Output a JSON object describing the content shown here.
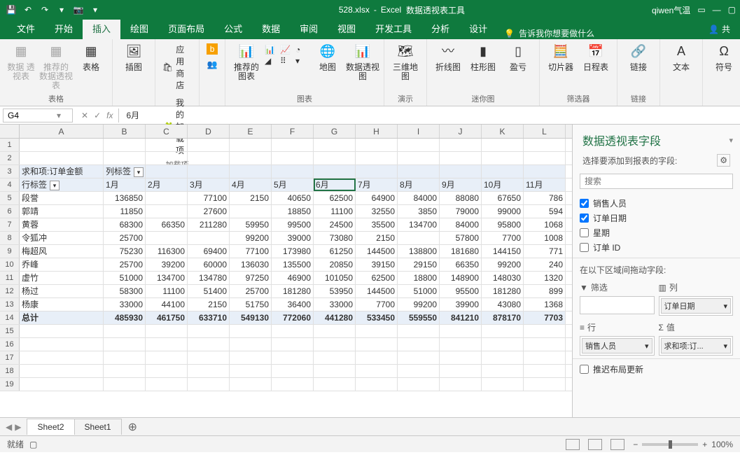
{
  "title": {
    "filename": "528.xlsx",
    "app": "Excel",
    "tool": "数据透视表工具",
    "user": "qiwen气温"
  },
  "tabs": [
    "文件",
    "开始",
    "插入",
    "绘图",
    "页面布局",
    "公式",
    "数据",
    "审阅",
    "视图",
    "开发工具",
    "分析",
    "设计"
  ],
  "tell": "告诉我你想要做什么",
  "share": "共",
  "ribbon": {
    "pivot": {
      "pt": "数据\n透视表",
      "rec": "推荐的\n数据透视表",
      "table": "表格",
      "group": "表格"
    },
    "illus": {
      "pic": "插图",
      "group": ""
    },
    "addins": {
      "store": "应用商店",
      "myaddins": "我的加载项",
      "bing": "",
      "people": "",
      "group": "加载项"
    },
    "charts": {
      "rec": "推荐的\n图表",
      "group": "图表",
      "map": "地图",
      "pivotchart": "数据透视图"
    },
    "tours": {
      "map": "三维地\n图",
      "group": "演示"
    },
    "spark": {
      "line": "折线图",
      "col": "柱形图",
      "winloss": "盈亏",
      "group": "迷你图"
    },
    "filter": {
      "slicer": "切片器",
      "timeline": "日程表",
      "group": "筛选器"
    },
    "link": {
      "link": "链接",
      "group": "链接"
    },
    "text": {
      "text": "文本",
      "group": ""
    },
    "sym": {
      "sym": "符号",
      "group": ""
    }
  },
  "formula": {
    "cell": "G4",
    "value": "6月",
    "fx": "fx"
  },
  "cols": [
    "A",
    "B",
    "C",
    "D",
    "E",
    "F",
    "G",
    "H",
    "I",
    "J",
    "K",
    "L"
  ],
  "pivot": {
    "measure": "求和项:订单金额",
    "collabel": "列标签",
    "rowlabel": "行标签",
    "months": [
      "1月",
      "2月",
      "3月",
      "4月",
      "5月",
      "6月",
      "7月",
      "8月",
      "9月",
      "10月",
      "11月"
    ],
    "rows": [
      {
        "name": "段誉",
        "v": [
          "136850",
          "",
          "77100",
          "2150",
          "40650",
          "62500",
          "64900",
          "84000",
          "88080",
          "67650",
          "786"
        ]
      },
      {
        "name": "郭靖",
        "v": [
          "11850",
          "",
          "27600",
          "",
          "18850",
          "11100",
          "32550",
          "3850",
          "79000",
          "99000",
          "594"
        ]
      },
      {
        "name": "黄蓉",
        "v": [
          "68300",
          "66350",
          "211280",
          "59950",
          "99500",
          "24500",
          "35500",
          "134700",
          "84000",
          "95800",
          "1068"
        ]
      },
      {
        "name": "令狐冲",
        "v": [
          "25700",
          "",
          "",
          "99200",
          "39000",
          "73080",
          "2150",
          "",
          "57800",
          "7700",
          "1008"
        ]
      },
      {
        "name": "梅超风",
        "v": [
          "75230",
          "116300",
          "69400",
          "77100",
          "173980",
          "61250",
          "144500",
          "138800",
          "181680",
          "144150",
          "771"
        ]
      },
      {
        "name": "乔峰",
        "v": [
          "25700",
          "39200",
          "60000",
          "136030",
          "135500",
          "20850",
          "39150",
          "29150",
          "66350",
          "99200",
          "240"
        ]
      },
      {
        "name": "虚竹",
        "v": [
          "51000",
          "134700",
          "134780",
          "97250",
          "46900",
          "101050",
          "62500",
          "18800",
          "148900",
          "148030",
          "1320"
        ]
      },
      {
        "name": "杨过",
        "v": [
          "58300",
          "11100",
          "51400",
          "25700",
          "181280",
          "53950",
          "144500",
          "51000",
          "95500",
          "181280",
          "899"
        ]
      },
      {
        "name": "杨康",
        "v": [
          "33000",
          "44100",
          "2150",
          "51750",
          "36400",
          "33000",
          "7700",
          "99200",
          "39900",
          "43080",
          "1368"
        ]
      }
    ],
    "total": {
      "name": "总计",
      "v": [
        "485930",
        "461750",
        "633710",
        "549130",
        "772060",
        "441280",
        "533450",
        "559550",
        "841210",
        "878170",
        "7703"
      ]
    }
  },
  "pane": {
    "title": "数据透视表字段",
    "subtitle": "选择要添加到报表的字段:",
    "searchPlaceholder": "搜索",
    "fields": [
      {
        "label": "销售人员",
        "checked": true
      },
      {
        "label": "订单日期",
        "checked": true
      },
      {
        "label": "星期",
        "checked": false
      },
      {
        "label": "订单 ID",
        "checked": false
      }
    ],
    "areasLabel": "在以下区域间拖动字段:",
    "areas": {
      "filter": {
        "label": "筛选"
      },
      "cols": {
        "label": "列",
        "item": "订单日期"
      },
      "rows": {
        "label": "行",
        "item": "销售人员"
      },
      "vals": {
        "label": "值",
        "item": "求和项:订..."
      }
    },
    "defer": "推迟布局更新"
  },
  "sheets": {
    "active": "Sheet2",
    "others": [
      "Sheet1"
    ]
  },
  "status": {
    "ready": "就绪",
    "zoom": "100%"
  },
  "chart_data": {
    "type": "table",
    "title": "求和项:订单金额",
    "categories": [
      "1月",
      "2月",
      "3月",
      "4月",
      "5月",
      "6月",
      "7月",
      "8月",
      "9月",
      "10月",
      "11月"
    ],
    "series": [
      {
        "name": "段誉",
        "values": [
          136850,
          null,
          77100,
          2150,
          40650,
          62500,
          64900,
          84000,
          88080,
          67650,
          786
        ]
      },
      {
        "name": "郭靖",
        "values": [
          11850,
          null,
          27600,
          null,
          18850,
          11100,
          32550,
          3850,
          79000,
          99000,
          594
        ]
      },
      {
        "name": "黄蓉",
        "values": [
          68300,
          66350,
          211280,
          59950,
          99500,
          24500,
          35500,
          134700,
          84000,
          95800,
          1068
        ]
      },
      {
        "name": "令狐冲",
        "values": [
          25700,
          null,
          null,
          99200,
          39000,
          73080,
          2150,
          null,
          57800,
          7700,
          1008
        ]
      },
      {
        "name": "梅超风",
        "values": [
          75230,
          116300,
          69400,
          77100,
          173980,
          61250,
          144500,
          138800,
          181680,
          144150,
          771
        ]
      },
      {
        "name": "乔峰",
        "values": [
          25700,
          39200,
          60000,
          136030,
          135500,
          20850,
          39150,
          29150,
          66350,
          99200,
          240
        ]
      },
      {
        "name": "虚竹",
        "values": [
          51000,
          134700,
          134780,
          97250,
          46900,
          101050,
          62500,
          18800,
          148900,
          148030,
          1320
        ]
      },
      {
        "name": "杨过",
        "values": [
          58300,
          11100,
          51400,
          25700,
          181280,
          53950,
          144500,
          51000,
          95500,
          181280,
          899
        ]
      },
      {
        "name": "杨康",
        "values": [
          33000,
          44100,
          2150,
          51750,
          36400,
          33000,
          7700,
          99200,
          39900,
          43080,
          1368
        ]
      }
    ],
    "totals": [
      485930,
      461750,
      633710,
      549130,
      772060,
      441280,
      533450,
      559550,
      841210,
      878170,
      7703
    ]
  }
}
